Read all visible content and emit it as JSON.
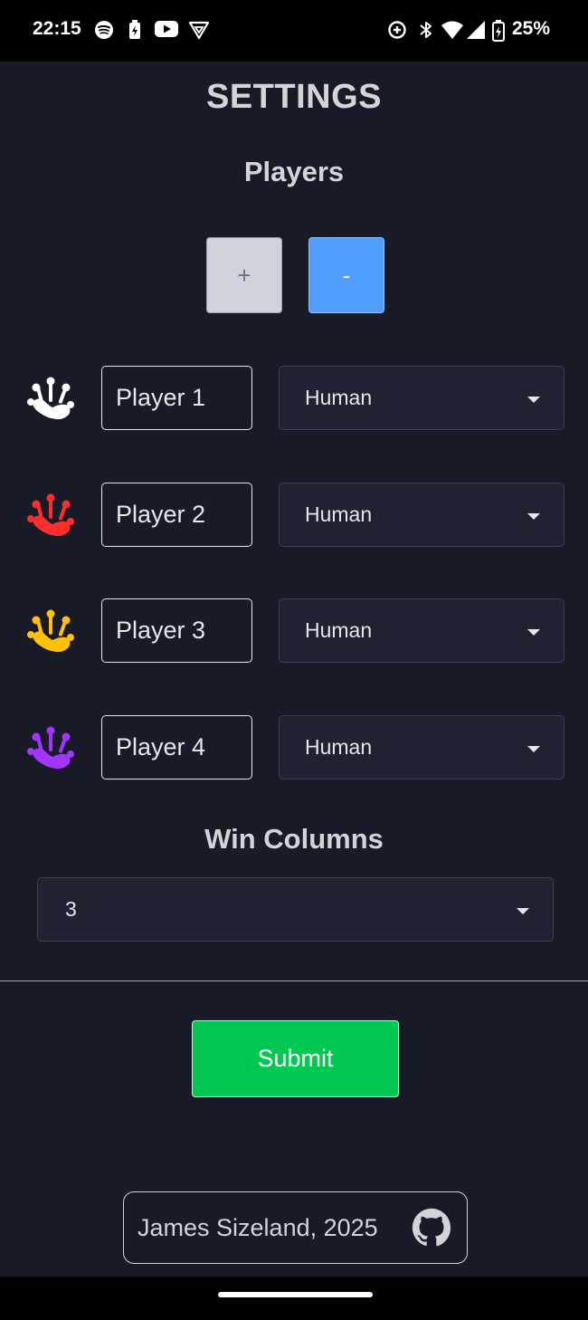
{
  "status_bar": {
    "time": "22:15",
    "battery": "25%"
  },
  "page": {
    "title": "SETTINGS",
    "players_heading": "Players",
    "add_label": "+",
    "remove_label": "-",
    "win_heading": "Win Columns",
    "win_value": "3",
    "submit_label": "Submit",
    "footer_text": "James Sizeland, 2025"
  },
  "players": [
    {
      "name": "Player 1",
      "type": "Human",
      "color": "#ffffff"
    },
    {
      "name": "Player 2",
      "type": "Human",
      "color": "#ff2d2d"
    },
    {
      "name": "Player 3",
      "type": "Human",
      "color": "#ffc107"
    },
    {
      "name": "Player 4",
      "type": "Human",
      "color": "#a335ff"
    }
  ],
  "icons": [
    "spotify-icon",
    "charging-icon",
    "youtube-icon",
    "vpn-icon",
    "data-saver-icon",
    "bluetooth-icon",
    "wifi-icon",
    "signal-icon",
    "battery-icon",
    "frog-foot-icon",
    "github-icon"
  ]
}
